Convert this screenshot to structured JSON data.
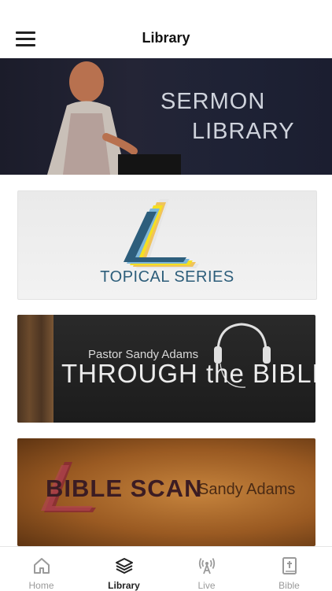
{
  "header": {
    "title": "Library"
  },
  "hero": {
    "line1": "SERMON",
    "line2": "LIBRARY"
  },
  "cards": [
    {
      "label": "TOPICAL SERIES"
    },
    {
      "name": "Pastor Sandy Adams",
      "title": "THROUGH the BIBLE"
    },
    {
      "title": "BIBLE SCAN",
      "sub": "Sandy Adams"
    }
  ],
  "tabs": [
    {
      "label": "Home",
      "icon": "home-icon"
    },
    {
      "label": "Library",
      "icon": "layers-icon"
    },
    {
      "label": "Live",
      "icon": "broadcast-icon"
    },
    {
      "label": "Bible",
      "icon": "bible-icon"
    }
  ],
  "colors": {
    "active": "#222222",
    "inactive": "#9a9a9a",
    "topical": "#2c5d7a"
  }
}
